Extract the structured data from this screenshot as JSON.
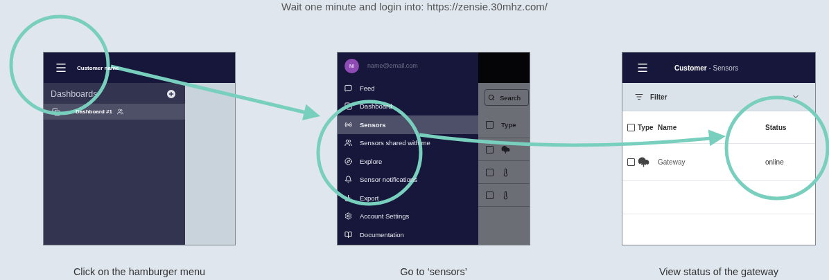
{
  "instruction": "Wait one minute and login into: https://zensie.30mhz.com/",
  "steps": [
    {
      "kind": "dashboards",
      "caption": "Click on the hamburger menu",
      "app": {
        "header_title": "Customer name",
        "sidebar_heading": "Dashboards",
        "dashboards": [
          {
            "label": "Dashboard #1",
            "shared": true,
            "selected": true
          }
        ]
      }
    },
    {
      "kind": "drawer",
      "caption": "Go to ‘sensors’",
      "app": {
        "user_initials": "NI",
        "user_email": "name@email.com",
        "menu": [
          {
            "label": "Feed",
            "selected": false
          },
          {
            "label": "Dashboard",
            "selected": false
          },
          {
            "label": "Sensors",
            "selected": true
          },
          {
            "label": "Sensors shared with me",
            "selected": false
          },
          {
            "label": "Explore",
            "selected": false
          },
          {
            "label": "Sensor notifications",
            "selected": false
          },
          {
            "label": "Export",
            "selected": false
          },
          {
            "label": "Account Settings",
            "selected": false
          },
          {
            "label": "Documentation",
            "selected": false
          }
        ],
        "search_placeholder": "Search",
        "table_header": "Type",
        "header_checked": false,
        "rows": [
          {
            "kind": "gateway",
            "checked": false
          },
          {
            "kind": "thermometer",
            "checked": false
          },
          {
            "kind": "thermometer",
            "checked": false
          }
        ]
      }
    },
    {
      "kind": "sensors",
      "caption": "View status of the gateway",
      "app": {
        "title": "**Customer** - Sensors",
        "filter_label": "Filter",
        "header_checked": false,
        "columns": [
          "Type",
          "Name",
          "Status"
        ],
        "rows": [
          {
            "kind": "gateway",
            "name": "Gateway",
            "status": "online",
            "checked": false
          }
        ]
      }
    }
  ]
}
